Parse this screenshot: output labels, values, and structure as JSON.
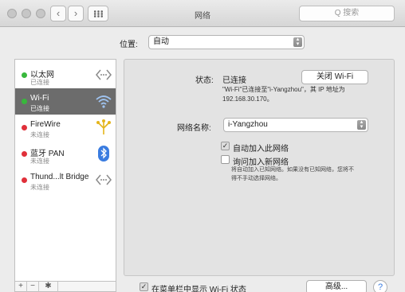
{
  "window": {
    "title": "网络"
  },
  "toolbar": {
    "back_icon": "chevron-left-icon",
    "forward_icon": "chevron-right-icon",
    "search_placeholder": "Q 搜索"
  },
  "location": {
    "label": "位置:",
    "value": "自动"
  },
  "sidebar": {
    "items": [
      {
        "name": "以太网",
        "status": "已连接",
        "status_color": "#38b83c",
        "icon": "ethernet-arrows-icon",
        "selected": false
      },
      {
        "name": "Wi-Fi",
        "status": "已连接",
        "status_color": "#38b83c",
        "icon": "wifi-icon",
        "selected": true
      },
      {
        "name": "FireWire",
        "status": "未连接",
        "status_color": "#e0303a",
        "icon": "firewire-icon",
        "selected": false
      },
      {
        "name": "蓝牙 PAN",
        "status": "未连接",
        "status_color": "#e0303a",
        "icon": "bluetooth-icon",
        "selected": false
      },
      {
        "name": "Thund...lt Bridge",
        "status": "未连接",
        "status_color": "#e0303a",
        "icon": "thunderbolt-arrows-icon",
        "selected": false
      }
    ],
    "bottom": {
      "add": "+",
      "remove": "−",
      "action": "✱"
    }
  },
  "detail": {
    "status_label": "状态:",
    "status_value": "已连接",
    "toggle_button": "关闭 Wi-Fi",
    "status_desc_line1": "\"Wi-Fi\"已连接至\"i-Yangzhou\"，其 IP 地址为",
    "status_desc_line2": "192.168.30.170。",
    "network_label": "网络名称:",
    "network_value": "i-Yangzhou",
    "auto_join_label": "自动加入此网络",
    "auto_join_checked": true,
    "ask_join_label": "询问加入新网络",
    "ask_join_checked": false,
    "ask_join_desc_line1": "将自动加入已知网络。如果没有已知网络，您将不",
    "ask_join_desc_line2": "得不手动选择网络。",
    "show_menu_label": "在菜单栏中显示 Wi-Fi 状态",
    "show_menu_checked": true,
    "advanced_button": "高级...",
    "help_button": "?"
  },
  "colors": {
    "accent": "#3a7ce0",
    "selected_row": "#6c6c6c",
    "connected": "#38b83c",
    "disconnected": "#e0303a"
  }
}
